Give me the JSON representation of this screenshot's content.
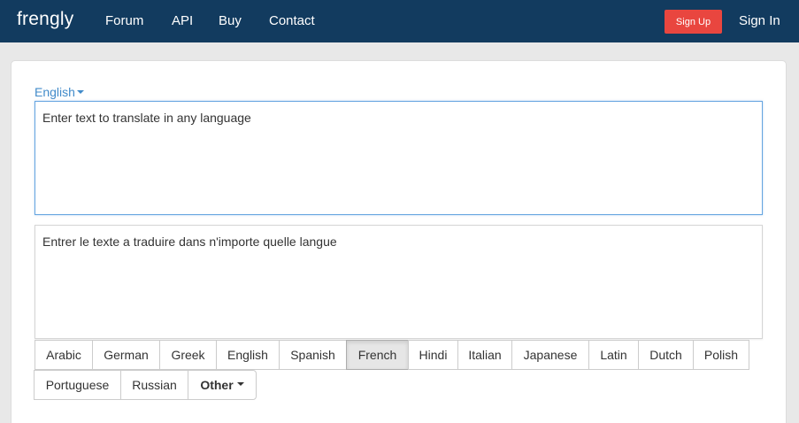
{
  "navbar": {
    "brand": "frengly",
    "links": [
      "Forum",
      "API",
      "Buy",
      "Contact"
    ],
    "signup_label": "Sign Up",
    "signin_label": "Sign In"
  },
  "translator": {
    "source_language": "English",
    "source_text": "Enter text to translate in any language",
    "target_text": "Entrer le texte a traduire dans n'importe quelle langue"
  },
  "languages": {
    "row1": [
      "Arabic",
      "German",
      "Greek",
      "English",
      "Spanish",
      "French",
      "Hindi",
      "Italian",
      "Japanese",
      "Latin",
      "Dutch",
      "Polish"
    ],
    "row2": [
      "Portuguese",
      "Russian"
    ],
    "other_label": "Other",
    "selected": "French"
  },
  "colors": {
    "navbar": "#123b5f",
    "signup": "#e9463f",
    "link": "#428bca"
  }
}
